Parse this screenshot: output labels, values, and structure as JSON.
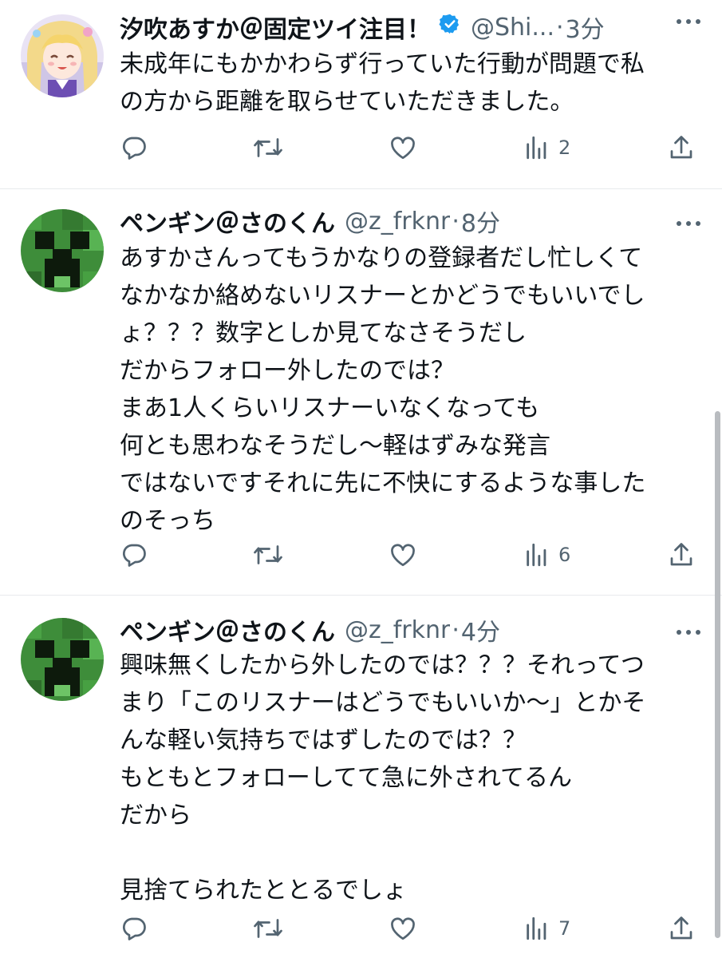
{
  "tweets": [
    {
      "display_name": "汐吹あすか＠固定ツイ注目！",
      "verified": true,
      "handle": "@Shi...",
      "separator": "·",
      "time": "3分",
      "avatar": "anime-girl-avatar",
      "text": "未成年にもかかわらず行っていた行動が問題で私\nの方から距離を取らせていただきました。",
      "actions": {
        "reply": "",
        "retweet": "",
        "like": "",
        "views": "2"
      }
    },
    {
      "display_name": "ペンギン＠さのくん",
      "verified": false,
      "handle": "@z_frknr",
      "separator": "·",
      "time": "8分",
      "avatar": "creeper-avatar",
      "text": "あすかさんってもうかなりの登録者だし忙しくて\nなかなか絡めないリスナーとかどうでもいいでし\nょ？？？数字としか見てなさそうだし\nだからフォロー外したのでは？\nまあ1人くらいリスナーいなくなっても\n何とも思わなそうだし〜軽はずみな発言\nではないですそれに先に不快にするような事した\nのそっち",
      "actions": {
        "reply": "",
        "retweet": "",
        "like": "",
        "views": "6"
      }
    },
    {
      "display_name": "ペンギン＠さのくん",
      "verified": false,
      "handle": "@z_frknr",
      "separator": "·",
      "time": "4分",
      "avatar": "creeper-avatar",
      "text": "興味無くしたから外したのでは？？？それってつ\nまり「このリスナーはどうでもいいか〜」とかそ\nんな軽い気持ちではずしたのでは？？\nもともとフォローしてて急に外されてるん\nだから\n\n見捨てられたととるでしょ",
      "actions": {
        "reply": "",
        "retweet": "",
        "like": "",
        "views": "7"
      }
    }
  ],
  "colors": {
    "text": "#0f1419",
    "secondary": "#536471",
    "verified_badge": "#1d9bf0",
    "divider": "#e8eaed"
  },
  "icons": [
    "reply-icon",
    "retweet-icon",
    "like-icon",
    "views-icon",
    "share-icon",
    "more-icon",
    "verified-badge-icon"
  ]
}
